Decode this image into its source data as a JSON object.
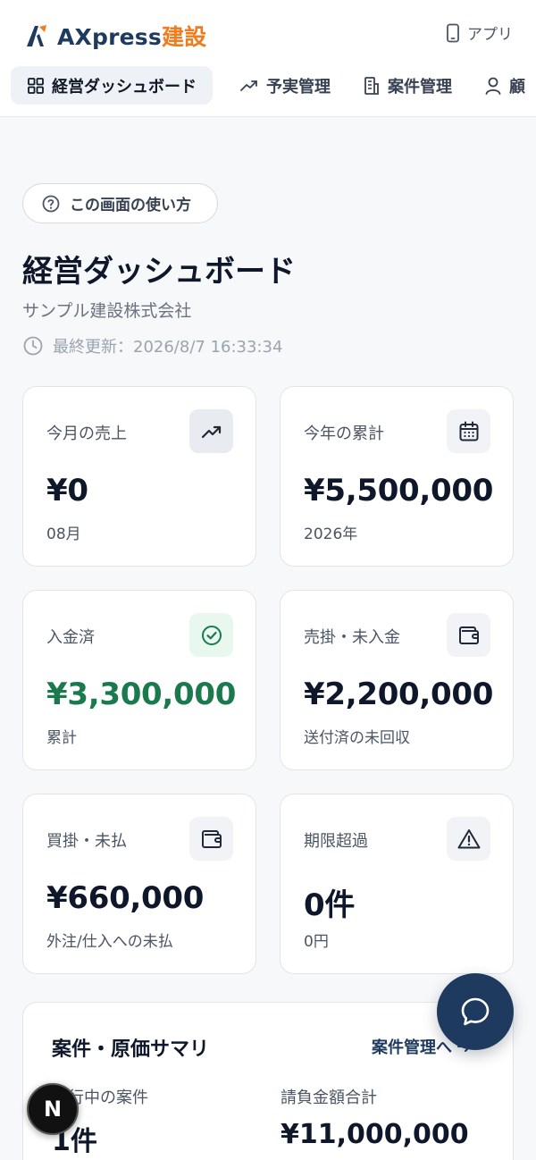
{
  "header": {
    "brand_main": "AXpress",
    "brand_accent": "建設",
    "app_link": "アプリ"
  },
  "nav": {
    "tabs": [
      {
        "label": "経営ダッシュボード",
        "icon": "grid-icon",
        "active": true
      },
      {
        "label": "予実管理",
        "icon": "trend-up-icon"
      },
      {
        "label": "案件管理",
        "icon": "building-icon"
      },
      {
        "label": "顧",
        "icon": "user-icon"
      }
    ]
  },
  "help": {
    "label": "この画面の使い方"
  },
  "page": {
    "title": "経営ダッシュボード",
    "company": "サンプル建設株式会社",
    "updated": "最終更新：2026/8/7 16:33:34"
  },
  "cards": [
    {
      "label": "今月の売上",
      "value": "¥0",
      "sub": "08月",
      "icon": "trend-up-icon"
    },
    {
      "label": "今年の累計",
      "value": "¥5,500,000",
      "sub": "2026年",
      "icon": "calendar-icon"
    },
    {
      "label": "入金済",
      "value": "¥3,300,000",
      "sub": "累計",
      "icon": "check-circle-icon"
    },
    {
      "label": "売掛・未入金",
      "value": "¥2,200,000",
      "sub": "送付済の未回収",
      "icon": "wallet-icon"
    },
    {
      "label": "買掛・未払",
      "value": "¥660,000",
      "sub": "外注/仕入への未払",
      "icon": "wallet-icon"
    },
    {
      "label": "期限超過",
      "value": "0件",
      "sub": "0円",
      "icon": "warning-icon"
    }
  ],
  "summary": {
    "title": "案件・原価サマリ",
    "link": "案件管理へ",
    "metrics": [
      {
        "label": "進行中の案件",
        "value": "1件"
      },
      {
        "label": "請負金額合計",
        "value": "¥11,000,000"
      }
    ]
  },
  "badges": {
    "dev": "N"
  },
  "colors": {
    "brand": "#1e3a5f",
    "accent": "#f07c1e",
    "positive": "#1b7a4d"
  }
}
